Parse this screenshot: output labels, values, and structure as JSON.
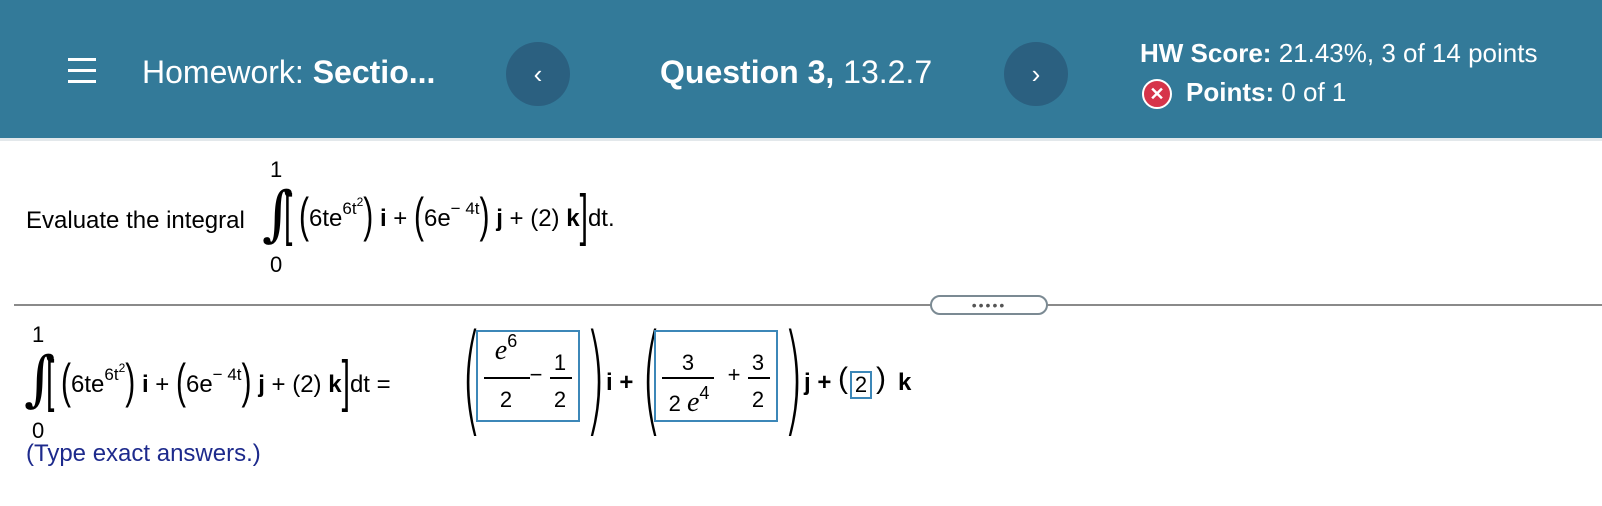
{
  "header": {
    "homework_label": "Homework:",
    "homework_name": "Sectio...",
    "prev_glyph": "‹",
    "next_glyph": "›",
    "question_label": "Question 3,",
    "question_id": "13.2.7",
    "score_label": "HW Score:",
    "score_value": "21.43%, 3 of 14 points",
    "points_label": "Points:",
    "points_value": "0 of 1",
    "bg_color": "#337a99"
  },
  "question": {
    "prompt": "Evaluate the integral",
    "upper_limit": "1",
    "lower_limit": "0",
    "coef1": "6te",
    "exp1": "6t",
    "exp1_sq": "2",
    "unit_i": "i",
    "coef2": "6e",
    "exp2": "− 4t",
    "unit_j": "j",
    "term3": "(2)",
    "unit_k": "k",
    "dt": "dt.",
    "dt_eq": "dt ="
  },
  "divider": {
    "handle_text": "•••••"
  },
  "answer": {
    "i_num1": "e",
    "i_num1_exp": "6",
    "i_den1": "2",
    "i_minus": "−",
    "i_num2": "1",
    "i_den2": "2",
    "i_label": "i +",
    "j_num1": "3",
    "j_den1": "2 e",
    "j_den1_exp": "4",
    "j_plus": "+",
    "j_num2": "3",
    "j_den2": "2",
    "j_label": "j +",
    "k_value": "2",
    "k_label": "k",
    "hint": "(Type exact answers.)"
  }
}
